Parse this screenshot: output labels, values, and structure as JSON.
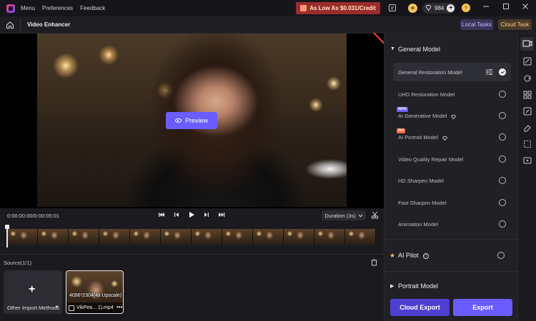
{
  "titlebar": {
    "menus": [
      "Menu",
      "Preferences",
      "Feedback"
    ],
    "promo": "As Low As $0.031/Credit",
    "credits": "984"
  },
  "header": {
    "title": "Video Enhancer",
    "local_tasks": "Local Tasks",
    "cloud_task": "Cloud Task"
  },
  "preview": {
    "button_label": "Preview"
  },
  "playback": {
    "timecode": "0:00:00:00/0:00:05:01",
    "duration": "Duration (3s)"
  },
  "source": {
    "label": "Source(1/1)",
    "import_label": "Other Import Methods",
    "clip_resolution": "4096*2304(4x Upscale)",
    "clip_name": "VikPea... 1).mp4"
  },
  "panel": {
    "general_title": "General Model",
    "models": [
      {
        "label": "General Restoration Model",
        "selected": true
      },
      {
        "label": "UHD Restoration Model"
      },
      {
        "label": "AI Generative Model",
        "badge": "NEW"
      },
      {
        "label": "AI Portrait Model",
        "badge": "Hot"
      },
      {
        "label": "Video Quality Repair Model"
      },
      {
        "label": "HD Sharpen Model"
      },
      {
        "label": "Fast Sharpen Model"
      },
      {
        "label": "Animation Model"
      }
    ],
    "ai_pilot": "AI Pilot",
    "portrait_title": "Portrait Model",
    "cloud_export": "Cloud Export",
    "export": "Export"
  },
  "colors": {
    "accent": "#6a5cff",
    "promo_bg": "#9c2c2c",
    "badge_new": "#6a5cff",
    "badge_hot": "#ff6a3d",
    "arrow": "#e84a3a"
  }
}
